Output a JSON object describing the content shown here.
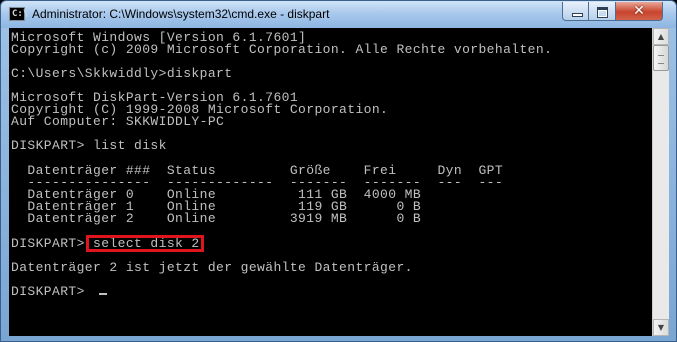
{
  "window": {
    "title": "Administrator: C:\\Windows\\system32\\cmd.exe - diskpart",
    "app_icon_glyph": "C:\\",
    "close_glyph": "✕",
    "icons": [
      "cmd-app-icon",
      "minimize-icon",
      "maximize-icon",
      "close-icon"
    ]
  },
  "console": {
    "lines": [
      "Microsoft Windows [Version 6.1.7601]",
      "Copyright (c) 2009 Microsoft Corporation. Alle Rechte vorbehalten.",
      "",
      "C:\\Users\\Skkwiddly>diskpart",
      "",
      "Microsoft DiskPart-Version 6.1.7601",
      "Copyright (C) 1999-2008 Microsoft Corporation.",
      "Auf Computer: SKKWIDDLY-PC",
      "",
      "DISKPART> list disk",
      "",
      "  Datenträger ###  Status         Größe    Frei     Dyn  GPT",
      "  ---------------  -------------  -------  -------  ---  ---",
      "  Datenträger 0    Online          111 GB  4000 MB",
      "  Datenträger 1    Online          119 GB      0 B",
      "  Datenträger 2    Online         3919 MB      0 B",
      "",
      "DISKPART> select disk 2",
      "",
      "Datenträger 2 ist jetzt der gewählte Datenträger.",
      "",
      "DISKPART> "
    ],
    "highlighted_command": "select disk 2",
    "highlight_color": "#e0141c",
    "text_color": "#c0c0c0",
    "background_color": "#000000"
  },
  "scrollbar": {
    "up_arrow": "▲",
    "down_arrow": "▼"
  }
}
